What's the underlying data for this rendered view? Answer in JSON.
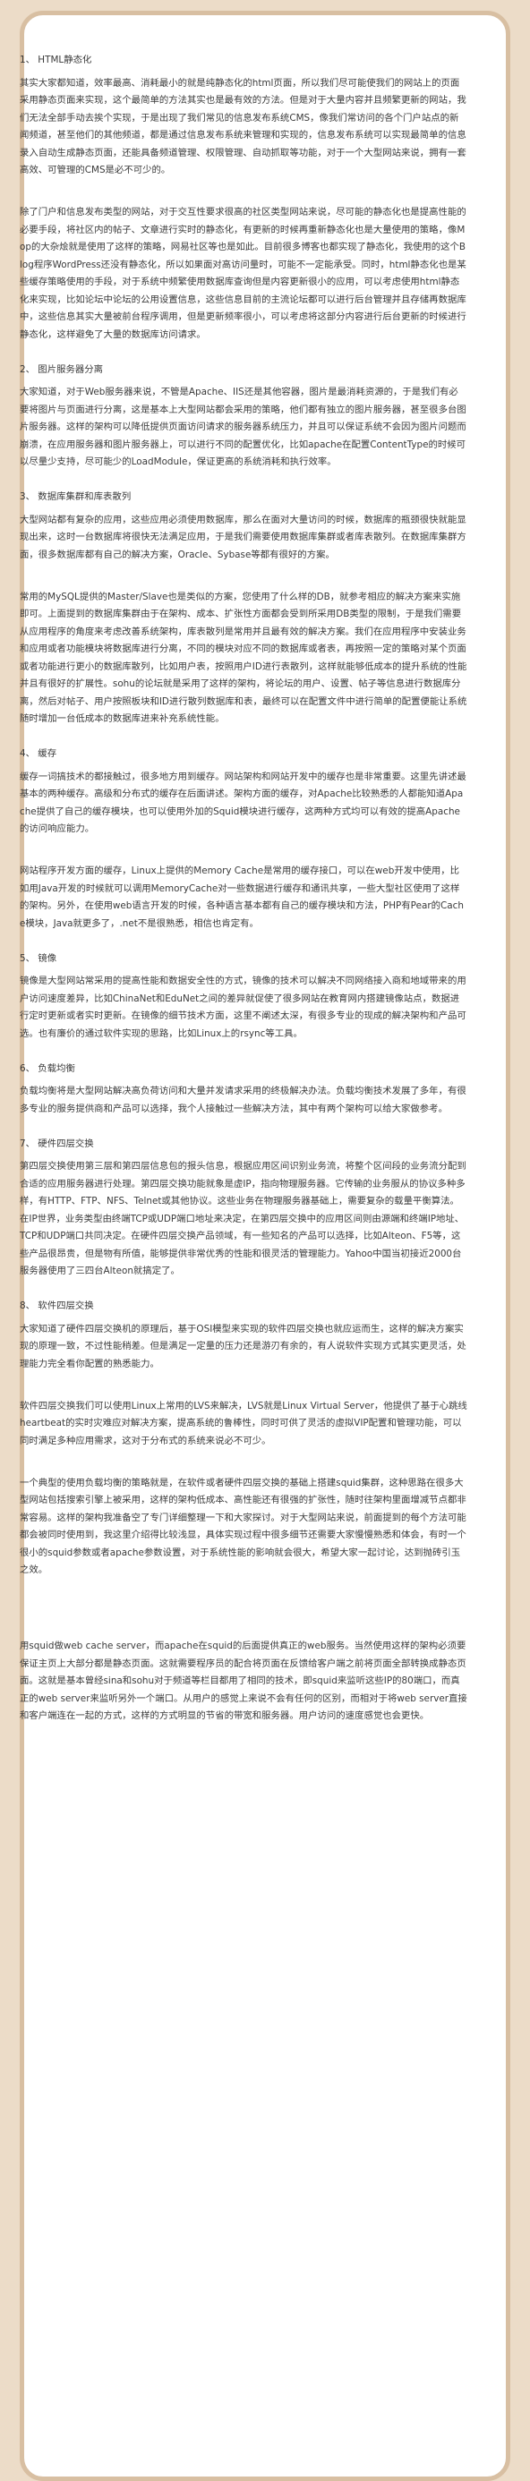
{
  "article": {
    "s1_title": "1、 HTML静态化",
    "s1_p1": "其实大家都知道，效率最高、消耗最小的就是纯静态化的html页面，所以我们尽可能使我们的网站上的页面采用静态页面来实现，这个最简单的方法其实也是最有效的方法。但是对于大量内容并且频繁更新的网站，我们无法全部手动去挨个实现，于是出现了我们常见的信息发布系统CMS，像我们常访问的各个门户站点的新闻频道，甚至他们的其他频道，都是通过信息发布系统来管理和实现的，信息发布系统可以实现最简单的信息录入自动生成静态页面，还能具备频道管理、权限管理、自动抓取等功能，对于一个大型网站来说，拥有一套高效、可管理的CMS是必不可少的。",
    "s1_p2": "除了门户和信息发布类型的网站，对于交互性要求很高的社区类型网站来说，尽可能的静态化也是提高性能的必要手段，将社区内的帖子、文章进行实时的静态化，有更新的时候再重新静态化也是大量使用的策略，像Mop的大杂烩就是使用了这样的策略，网易社区等也是如此。目前很多博客也都实现了静态化，我使用的这个Blog程序WordPress还没有静态化，所以如果面对高访问量时，可能不一定能承受。同时，html静态化也是某些缓存策略使用的手段，对于系统中频繁使用数据库查询但是内容更新很小的应用，可以考虑使用html静态化来实现，比如论坛中论坛的公用设置信息，这些信息目前的主流论坛都可以进行后台管理并且存储再数据库中，这些信息其实大量被前台程序调用，但是更新频率很小，可以考虑将这部分内容进行后台更新的时候进行静态化，这样避免了大量的数据库访问请求。",
    "s2_title": "2、 图片服务器分离",
    "s2_p1": "大家知道，对于Web服务器来说，不管是Apache、IIS还是其他容器，图片是最消耗资源的，于是我们有必要将图片与页面进行分离，这是基本上大型网站都会采用的策略，他们都有独立的图片服务器，甚至很多台图片服务器。这样的架构可以降低提供页面访问请求的服务器系统压力，并且可以保证系统不会因为图片问题而崩溃，在应用服务器和图片服务器上，可以进行不同的配置优化，比如apache在配置ContentType的时候可以尽量少支持，尽可能少的LoadModule，保证更高的系统消耗和执行效率。",
    "s3_title": "3、 数据库集群和库表散列",
    "s3_p1": "大型网站都有复杂的应用，这些应用必须使用数据库，那么在面对大量访问的时候，数据库的瓶颈很快就能显现出来，这时一台数据库将很快无法满足应用，于是我们需要使用数据库集群或者库表散列。在数据库集群方面，很多数据库都有自己的解决方案，Oracle、Sybase等都有很好的方案。",
    "s3_p2": "常用的MySQL提供的Master/Slave也是类似的方案，您使用了什么样的DB，就参考相应的解决方案来实施即可。上面提到的数据库集群由于在架构、成本、扩张性方面都会受到所采用DB类型的限制，于是我们需要从应用程序的角度来考虑改善系统架构，库表散列是常用并且最有效的解决方案。我们在应用程序中安装业务和应用或者功能模块将数据库进行分离，不同的模块对应不同的数据库或者表，再按照一定的策略对某个页面或者功能进行更小的数据库散列，比如用户表，按照用户ID进行表散列，这样就能够低成本的提升系统的性能并且有很好的扩展性。sohu的论坛就是采用了这样的架构，将论坛的用户、设置、帖子等信息进行数据库分离，然后对帖子、用户按照板块和ID进行散列数据库和表，最终可以在配置文件中进行简单的配置便能让系统随时增加一台低成本的数据库进来补充系统性能。",
    "s4_title": "4、 缓存",
    "s4_p1": "缓存一词搞技术的都接触过，很多地方用到缓存。网站架构和网站开发中的缓存也是非常重要。这里先讲述最基本的两种缓存。高级和分布式的缓存在后面讲述。架构方面的缓存，对Apache比较熟悉的人都能知道Apache提供了自己的缓存模块，也可以使用外加的Squid模块进行缓存，这两种方式均可以有效的提高Apache的访问响应能力。",
    "s4_p2": "网站程序开发方面的缓存，Linux上提供的Memory Cache是常用的缓存接口，可以在web开发中使用，比如用Java开发的时候就可以调用MemoryCache对一些数据进行缓存和通讯共享，一些大型社区使用了这样的架构。另外，在使用web语言开发的时候，各种语言基本都有自己的缓存模块和方法，PHP有Pear的Cache模块，Java就更多了，.net不是很熟悉，相信也肯定有。",
    "s5_title": "5、 镜像",
    "s5_p1": "镜像是大型网站常采用的提高性能和数据安全性的方式，镜像的技术可以解决不同网络接入商和地域带来的用户访问速度差异，比如ChinaNet和EduNet之间的差异就促使了很多网站在教育网内搭建镜像站点，数据进行定时更新或者实时更新。在镜像的细节技术方面，这里不阐述太深，有很多专业的现成的解决架构和产品可选。也有廉价的通过软件实现的思路，比如Linux上的rsync等工具。",
    "s6_title": "6、 负载均衡",
    "s6_p1": "负载均衡将是大型网站解决高负荷访问和大量并发请求采用的终极解决办法。负载均衡技术发展了多年，有很多专业的服务提供商和产品可以选择，我个人接触过一些解决方法，其中有两个架构可以给大家做参考。",
    "s7_title": "7、 硬件四层交换",
    "s7_p1": "第四层交换使用第三层和第四层信息包的报头信息，根据应用区间识别业务流，将整个区间段的业务流分配到合适的应用服务器进行处理。第四层交换功能就象是虚IP，指向物理服务器。它传输的业务服从的协议多种多样，有HTTP、FTP、NFS、Telnet或其他协议。这些业务在物理服务器基础上，需要复杂的载量平衡算法。在IP世界，业务类型由终端TCP或UDP端口地址来决定，在第四层交换中的应用区间则由源端和终端IP地址、TCP和UDP端口共同决定。在硬件四层交换产品领域，有一些知名的产品可以选择，比如Alteon、F5等，这些产品很昂贵，但是物有所值，能够提供非常优秀的性能和很灵活的管理能力。Yahoo中国当初接近2000台服务器使用了三四台Alteon就搞定了。",
    "s8_title": "8、 软件四层交换",
    "s8_p1": "大家知道了硬件四层交换机的原理后，基于OSI模型来实现的软件四层交换也就应运而生，这样的解决方案实现的原理一致，不过性能稍差。但是满足一定量的压力还是游刃有余的，有人说软件实现方式其实更灵活，处理能力完全看你配置的熟悉能力。",
    "s8_p2": "软件四层交换我们可以使用Linux上常用的LVS来解决，LVS就是Linux Virtual Server，他提供了基于心跳线heartbeat的实时灾难应对解决方案，提高系统的鲁棒性，同时可供了灵活的虚拟VIP配置和管理功能，可以同时满足多种应用需求，这对于分布式的系统来说必不可少。",
    "s8_p3": "一个典型的使用负载均衡的策略就是，在软件或者硬件四层交换的基础上搭建squid集群，这种思路在很多大型网站包括搜索引擎上被采用，这样的架构低成本、高性能还有很强的扩张性，随时往架构里面增减节点都非常容易。这样的架构我准备空了专门详细整理一下和大家探讨。对于大型网站来说，前面提到的每个方法可能都会被同时使用到，我这里介绍得比较浅显，具体实现过程中很多细节还需要大家慢慢熟悉和体会，有时一个很小的squid参数或者apache参数设置，对于系统性能的影响就会很大，希望大家一起讨论，达到抛砖引玉之效。",
    "s8_p4": "用squid做web cache server，而apache在squid的后面提供真正的web服务。当然使用这样的架构必须要保证主页上大部分都是静态页面。这就需要程序员的配合将页面在反馈给客户端之前将页面全部转换成静态页面。这就是基本曾经sina和sohu对于频道等栏目都用了相同的技术，即squid来监听这些IP的80端口，而真正的web server来监听另外一个端口。从用户的感觉上来说不会有任何的区别，而相对于将web server直接和客户端连在一起的方式，这样的方式明显的节省的带宽和服务器。用户访问的速度感觉也会更快。"
  }
}
